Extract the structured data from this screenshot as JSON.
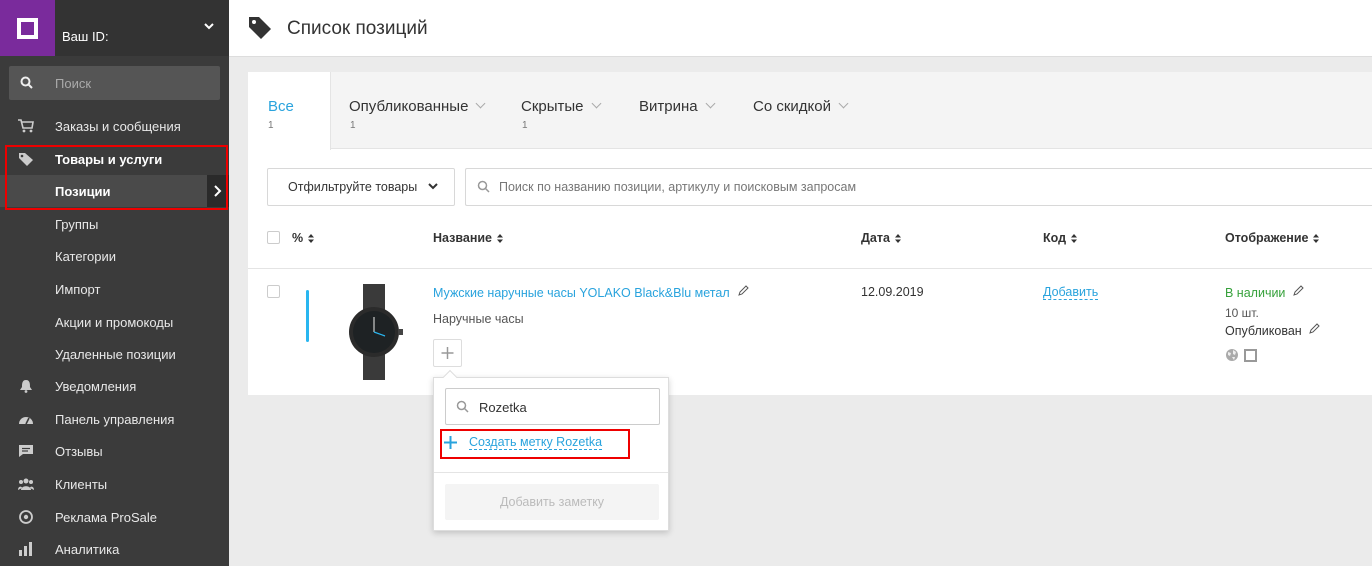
{
  "sidebar": {
    "your_id": "Ваш ID:",
    "search_placeholder": "Поиск",
    "items": [
      {
        "label": "Заказы и сообщения",
        "icon": "cart-icon"
      },
      {
        "label": "Товары и услуги",
        "icon": "tag-icon"
      },
      {
        "label": "Позиции"
      },
      {
        "label": "Группы"
      },
      {
        "label": "Категории"
      },
      {
        "label": "Импорт"
      },
      {
        "label": "Акции и промокоды"
      },
      {
        "label": "Удаленные позиции"
      },
      {
        "label": "Уведомления",
        "icon": "bell-icon"
      },
      {
        "label": "Панель управления",
        "icon": "gauge-icon"
      },
      {
        "label": "Отзывы",
        "icon": "comment-icon"
      },
      {
        "label": "Клиенты",
        "icon": "users-icon"
      },
      {
        "label": "Реклама ProSale",
        "icon": "target-icon"
      },
      {
        "label": "Аналитика",
        "icon": "bar-chart-icon"
      }
    ]
  },
  "header": {
    "title": "Список позиций"
  },
  "tabs": [
    {
      "label": "Все",
      "count": "1"
    },
    {
      "label": "Опубликованные",
      "count": "1"
    },
    {
      "label": "Скрытые",
      "count": "1"
    },
    {
      "label": "Витрина",
      "count": ""
    },
    {
      "label": "Со скидкой",
      "count": ""
    }
  ],
  "filter": {
    "label": "Отфильтруйте товары"
  },
  "search": {
    "placeholder": "Поиск по названию позиции, артикулу и поисковым запросам"
  },
  "table": {
    "columns": {
      "percent": "%",
      "name": "Название",
      "date": "Дата",
      "code": "Код",
      "display": "Отображение"
    },
    "row": {
      "name": "Мужские наручные часы YOLAKO Black&Blu метал",
      "category": "Наручные часы",
      "date": "12.09.2019",
      "code_action": "Добавить",
      "status": "В наличии",
      "quantity": "10 шт.",
      "published": "Опубликован"
    }
  },
  "popup": {
    "input_value": "Rozetka",
    "create_tag": "Создать метку Rozetka",
    "add_note": "Добавить заметку"
  },
  "colors": {
    "accent": "#29a3dd",
    "brand": "#7a2b9c",
    "success": "#36a13b",
    "highlight": "#e00000"
  }
}
